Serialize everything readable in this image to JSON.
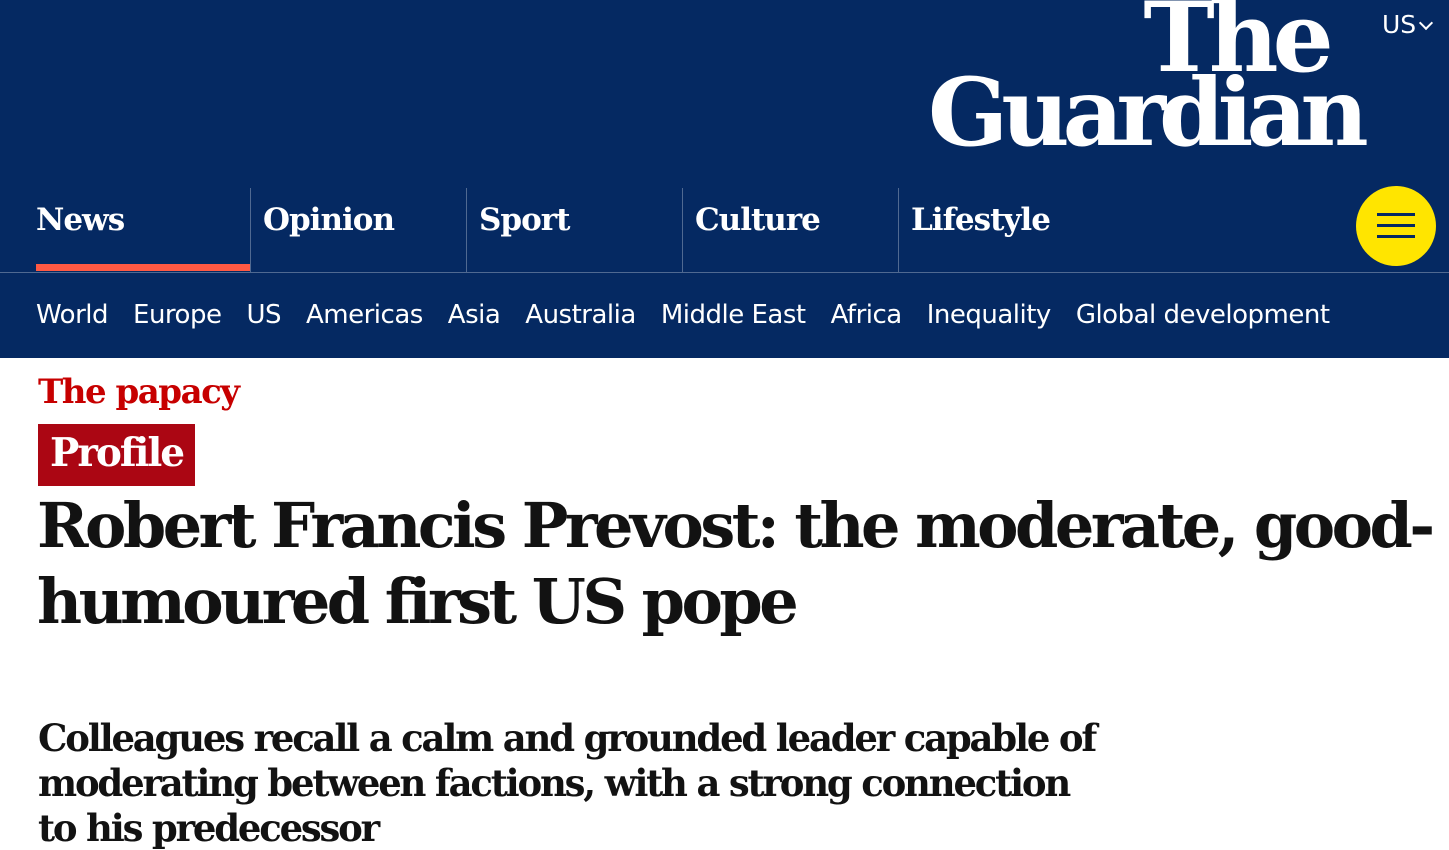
{
  "edition": {
    "label": "US"
  },
  "logo": {
    "line1": "The",
    "line2": "Guardian"
  },
  "pillars": [
    {
      "label": "News",
      "active": true
    },
    {
      "label": "Opinion"
    },
    {
      "label": "Sport"
    },
    {
      "label": "Culture"
    },
    {
      "label": "Lifestyle"
    }
  ],
  "subnav": [
    "World",
    "Europe",
    "US",
    "Americas",
    "Asia",
    "Australia",
    "Middle East",
    "Africa",
    "Inequality",
    "Global development"
  ],
  "article": {
    "kicker": "The papacy",
    "badge": "Profile",
    "headline": "Robert Francis Prevost: the moderate, good-humoured first US pope",
    "standfirst": "Colleagues recall a calm and grounded leader capable of moderating between factions, with a strong connection to his predecessor"
  },
  "colors": {
    "brand": "#052962",
    "news_accent": "#ff5943",
    "menu_button": "#ffe500",
    "kicker": "#c70000",
    "badge": "#ab0613"
  }
}
